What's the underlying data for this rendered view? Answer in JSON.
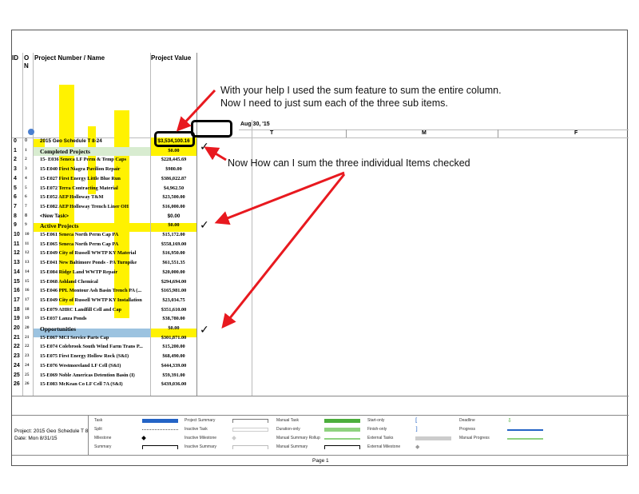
{
  "headers": {
    "id": "ID",
    "o": "O",
    "n": "N",
    "name": "Project Number / Name",
    "value": "Project Value"
  },
  "timescale": {
    "week": "Aug 30, '15",
    "day_t": "T",
    "day_m": "M",
    "day_f": "F"
  },
  "rows": [
    {
      "id": "0",
      "c2": "0",
      "name": "2015 Geo Schedule T 8-24",
      "value": "$3,534,100.16"
    },
    {
      "id": "1",
      "c2": "1",
      "name": "Completed Projects",
      "value": "$0.00"
    },
    {
      "id": "2",
      "c2": "2",
      "name": "15- E036 Seneca LF Perm & Temp Caps",
      "value": "$228,445.69"
    },
    {
      "id": "3",
      "c2": "3",
      "name": "15-E040 First Niagra Pavilion Repair",
      "value": "$980.00"
    },
    {
      "id": "4",
      "c2": "4",
      "name": "15-E027 First Energy Little Blue Run",
      "value": "$386,022.87"
    },
    {
      "id": "5",
      "c2": "5",
      "name": "15-E072 Terra Contracting Material",
      "value": "$4,962.50"
    },
    {
      "id": "6",
      "c2": "6",
      "name": "15-E052 AEP Holloway T&M",
      "value": "$23,500.00"
    },
    {
      "id": "7",
      "c2": "7",
      "name": "15-E082 AEP Holloway Trench Liner OH",
      "value": "$16,000.00"
    },
    {
      "id": "8",
      "c2": "8",
      "name": "<New Task>",
      "value": "$0.00"
    },
    {
      "id": "9",
      "c2": "9",
      "name": "Active Projects",
      "value": "$0.00"
    },
    {
      "id": "10",
      "c2": "10",
      "name": "15-E061 Seneca North Perm Cap PA",
      "value": "$15,172.00"
    },
    {
      "id": "11",
      "c2": "11",
      "name": "15-E065 Seneca North Perm Cap PA",
      "value": "$558,169.00"
    },
    {
      "id": "12",
      "c2": "12",
      "name": "15-E049 City of Russell WWTP KY Material",
      "value": "$16,950.00"
    },
    {
      "id": "13",
      "c2": "13",
      "name": "15-E041 New Baltimore Ponds - PA Turnpike",
      "value": "$61,551.35"
    },
    {
      "id": "14",
      "c2": "14",
      "name": "15-E084 Ridge Land WWTP Repair",
      "value": "$20,000.00"
    },
    {
      "id": "15",
      "c2": "15",
      "name": "15-E068 Ashland Chemical",
      "value": "$294,694.00"
    },
    {
      "id": "16",
      "c2": "16",
      "name": "15-E046 PPL Montour Ash Basin Trench PA (...",
      "value": "$165,981.00"
    },
    {
      "id": "17",
      "c2": "17",
      "name": "15-E049 City of Russell WWTP KY Installation",
      "value": "$23,034.75"
    },
    {
      "id": "18",
      "c2": "18",
      "name": "15-E079 AHRC Landfill Cell and Cap",
      "value": "$351,610.00"
    },
    {
      "id": "19",
      "c2": "19",
      "name": "15-E037 Lanza Ponds",
      "value": "$38,780.00"
    },
    {
      "id": "20",
      "c2": "20",
      "name": "Opportunities",
      "value": "$0.00"
    },
    {
      "id": "21",
      "c2": "21",
      "name": "15-E067 MCI Service Parts Cap",
      "value": "$301,871.00"
    },
    {
      "id": "22",
      "c2": "22",
      "name": "15-E074 Colebrook South Wind Farm Trans P...",
      "value": "$15,200.00"
    },
    {
      "id": "23",
      "c2": "23",
      "name": "15-E075 First Energy Hollow Rock (S&I)",
      "value": "$68,490.00"
    },
    {
      "id": "24",
      "c2": "24",
      "name": "15-E076 Westmoreland LF Cell (S&I)",
      "value": "$444,339.00"
    },
    {
      "id": "25",
      "c2": "25",
      "name": "15-E069 Noble Americas Detention Basin (I)",
      "value": "$59,391.00"
    },
    {
      "id": "26",
      "c2": "26",
      "name": "15-E083 McKean Co LF Cell 7A (S&I)",
      "value": "$439,036.00"
    }
  ],
  "annotations": {
    "top_note_1": "With your help I used the sum feature to sum the entire column.",
    "top_note_2": "Now I need to just sum each of the three sub items.",
    "mid_note": "Now How can I sum the three individual Items checked",
    "checkmark": "✓"
  },
  "footer": {
    "project": "Project: 2015 Geo Schedule T 8",
    "date": "Date: Mon 8/31/15",
    "page": "Page 1",
    "legend": [
      "Task",
      "Split",
      "Milestone",
      "Summary",
      "Project Summary",
      "Inactive Task",
      "Inactive Milestone",
      "Inactive Summary",
      "Manual Task",
      "Duration-only",
      "Manual Summary Rollup",
      "Manual Summary",
      "Start-only",
      "Finish-only",
      "External Tasks",
      "External Milestone",
      "Deadline",
      "Progress",
      "Manual Progress"
    ]
  },
  "colors": {
    "highlight": "#fff200",
    "completed_band": "#d8ecd0",
    "opportunities_band": "#9cc3e0",
    "arrow": "#e8191f",
    "task_bar": "#2464c6",
    "manual_task": "#4cae3c"
  }
}
